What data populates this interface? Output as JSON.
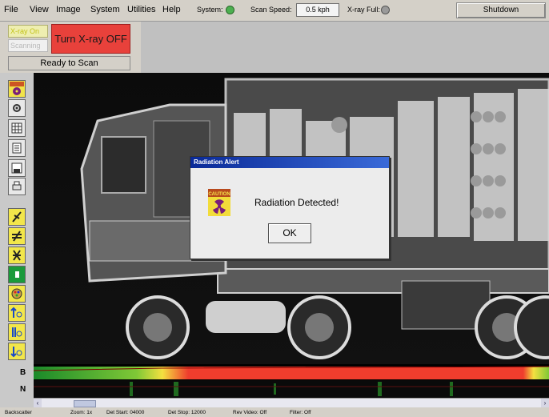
{
  "menu": {
    "items": [
      {
        "label": "File"
      },
      {
        "label": "View"
      },
      {
        "label": "Image"
      },
      {
        "label": "System"
      },
      {
        "label": "Utilities"
      },
      {
        "label": "Help"
      }
    ]
  },
  "status_header": {
    "system_label": "System:",
    "system_led_color": "#4caf50",
    "scan_speed_label": "Scan Speed:",
    "scan_speed_value": "0.5 kph",
    "xray_full_label": "X-ray Full:",
    "xray_full_led_color": "#9a9a9a",
    "shutdown_label": "Shutdown"
  },
  "control_panel": {
    "xray_on_label": "X-ray On",
    "scanning_label": "Scanning",
    "turn_off_label": "Turn X-ray OFF",
    "ready_label": "Ready to Scan",
    "turn_off_color": "#e8413b"
  },
  "toolbar": {
    "tools": [
      {
        "icon": "radiation-rid-icon"
      },
      {
        "icon": "pan-icon"
      },
      {
        "icon": "grid-icon"
      },
      {
        "icon": "document-icon"
      },
      {
        "icon": "save-icon"
      },
      {
        "icon": "print-icon"
      },
      {
        "icon": "tool-a-icon"
      },
      {
        "icon": "tool-b-icon"
      },
      {
        "icon": "tool-c-icon"
      },
      {
        "icon": "contrast-icon"
      },
      {
        "icon": "palette-icon"
      },
      {
        "icon": "zoom-up-icon"
      },
      {
        "icon": "zoom-bar-icon"
      },
      {
        "icon": "zoom-down-icon"
      }
    ]
  },
  "dialog": {
    "title": "Radiation Alert",
    "caution_text": "CAUTION",
    "message": "Radiation Detected!",
    "ok_label": "OK"
  },
  "strips": {
    "b_label": "B",
    "n_label": "N"
  },
  "statusbar": {
    "mode": "Backscatter",
    "zoom": "Zoom: 1x",
    "det_start": "Det Start: 04000",
    "det_stop": "Det Stop: 12000",
    "rev_video": "Rev Video: Off",
    "filter": "Filter: Off"
  }
}
